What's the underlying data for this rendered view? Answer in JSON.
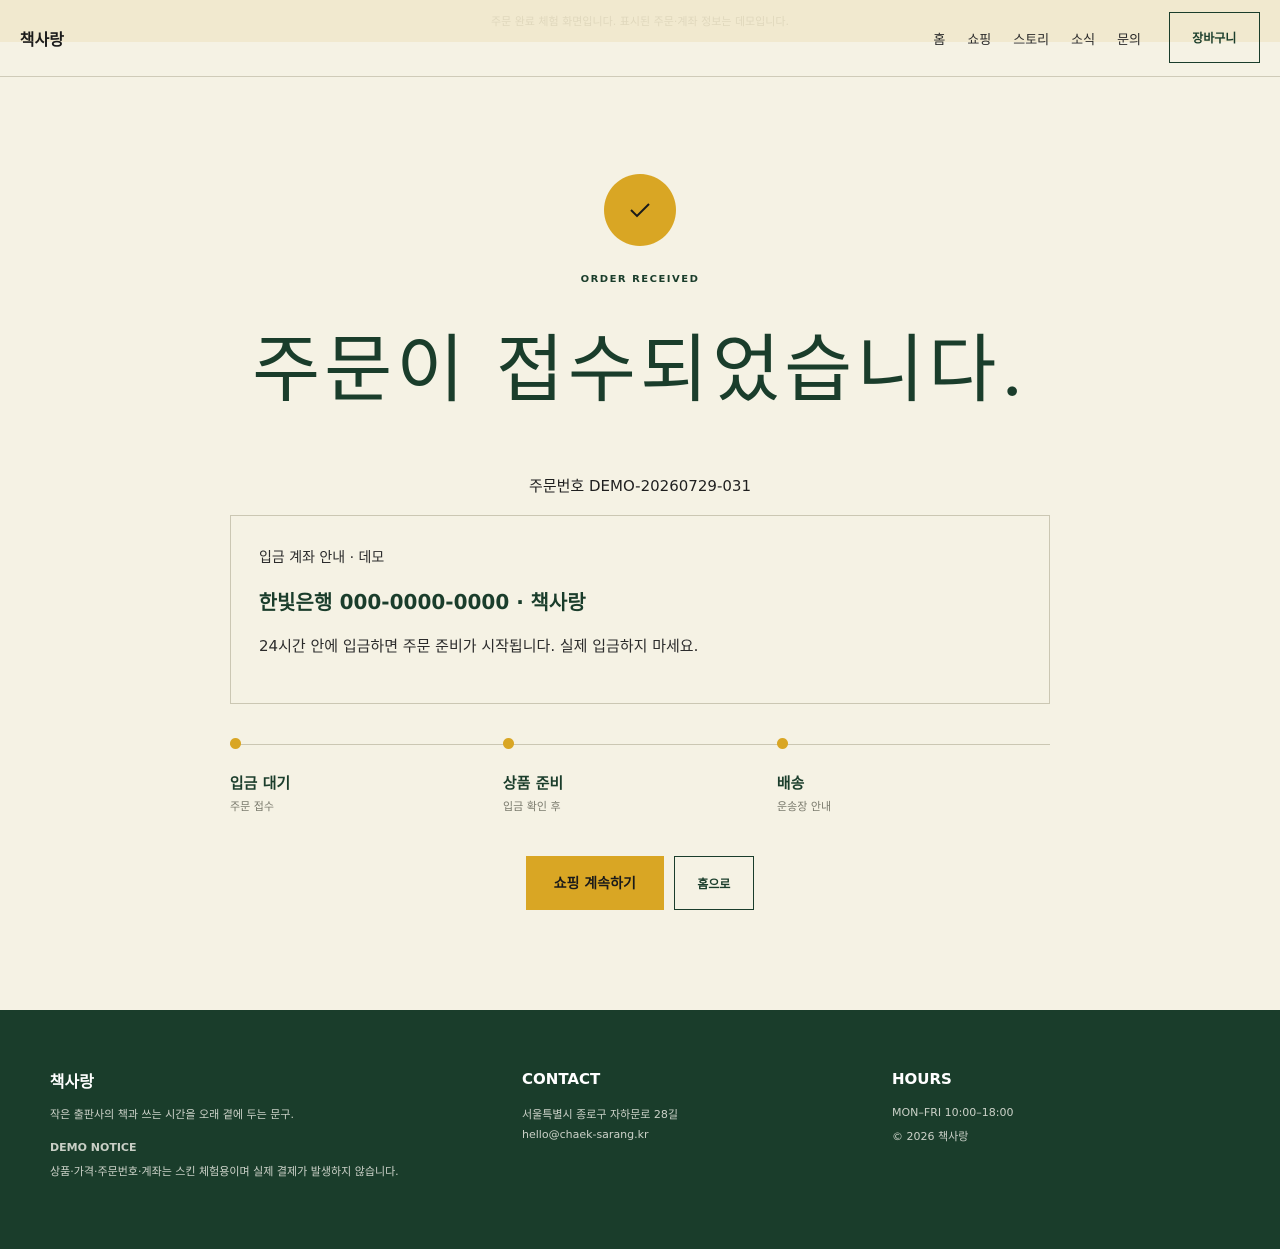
{
  "notice_bar": {
    "text": "주문 완료 체험 화면입니다. 표시된 주문·계좌 정보는 데모입니다."
  },
  "header": {
    "brand": "책사랑",
    "nav": [
      "홈",
      "쇼핑",
      "스토리",
      "소식",
      "문의"
    ],
    "cart_label": "장바구니"
  },
  "main": {
    "icon": "check-icon",
    "eyebrow": "ORDER RECEIVED",
    "title": "주문이 접수되었습니다.",
    "order_number": "주문번호 DEMO-20260729-031",
    "bank": {
      "label": "입금 계좌 안내 · 데모",
      "account": "한빛은행 000-0000-0000 · 책사랑",
      "note": "24시간 안에 입금하면 주문 준비가 시작됩니다. 실제 입금하지 마세요."
    },
    "steps": [
      {
        "title": "입금 대기",
        "sub": "주문 접수"
      },
      {
        "title": "상품 준비",
        "sub": "입금 확인 후"
      },
      {
        "title": "배송",
        "sub": "운송장 안내"
      }
    ],
    "primary_button": "쇼핑 계속하기",
    "secondary_button": "홈으로"
  },
  "footer": {
    "brand": "책사랑",
    "tagline": "작은 출판사의 책과 쓰는 시간을 오래 곁에 두는 문구.",
    "notice_heading": "DEMO NOTICE",
    "notice_text": "상품·가격·주문번호·계좌는 스킨 체험용이며 실제 결제가 발생하지 않습니다.",
    "contact_heading": "CONTACT",
    "address": "서울특별시 종로구 자하문로 28길",
    "email": "hello@chaek-sarang.kr",
    "hours_heading": "HOURS",
    "hours": "MON–FRI 10:00–18:00",
    "copyright": "© 2026 책사랑"
  },
  "colors": {
    "background": "#f5f2e4",
    "accent": "#d9a624",
    "primary": "#1a3d2b"
  }
}
